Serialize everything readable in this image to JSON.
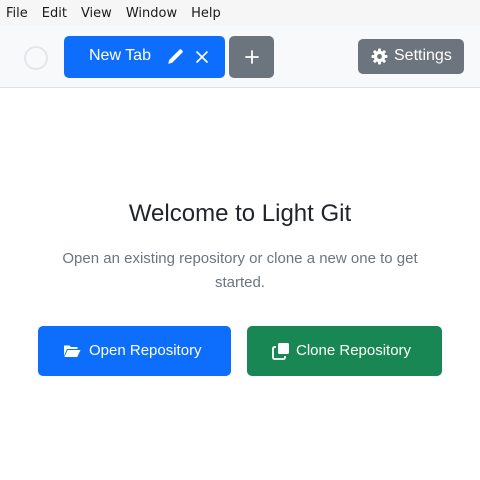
{
  "menubar": {
    "items": [
      "File",
      "Edit",
      "View",
      "Window",
      "Help"
    ]
  },
  "tabs": {
    "active_tab_label": "New Tab",
    "new_tab_symbol": "+",
    "settings_label": "Settings"
  },
  "welcome": {
    "title": "Welcome to Light Git",
    "subtitle": "Open an existing repository or clone a new one to get started."
  },
  "actions": {
    "open_label": "Open Repository",
    "clone_label": "Clone Repository"
  },
  "icons": {
    "tab_edit": "pencil-icon",
    "tab_close": "close-icon",
    "settings": "gear-icon",
    "open": "folder-open-icon",
    "clone": "clone-icon"
  },
  "colors": {
    "primary": "#0d6efd",
    "secondary": "#6c757d",
    "success": "#198754"
  }
}
